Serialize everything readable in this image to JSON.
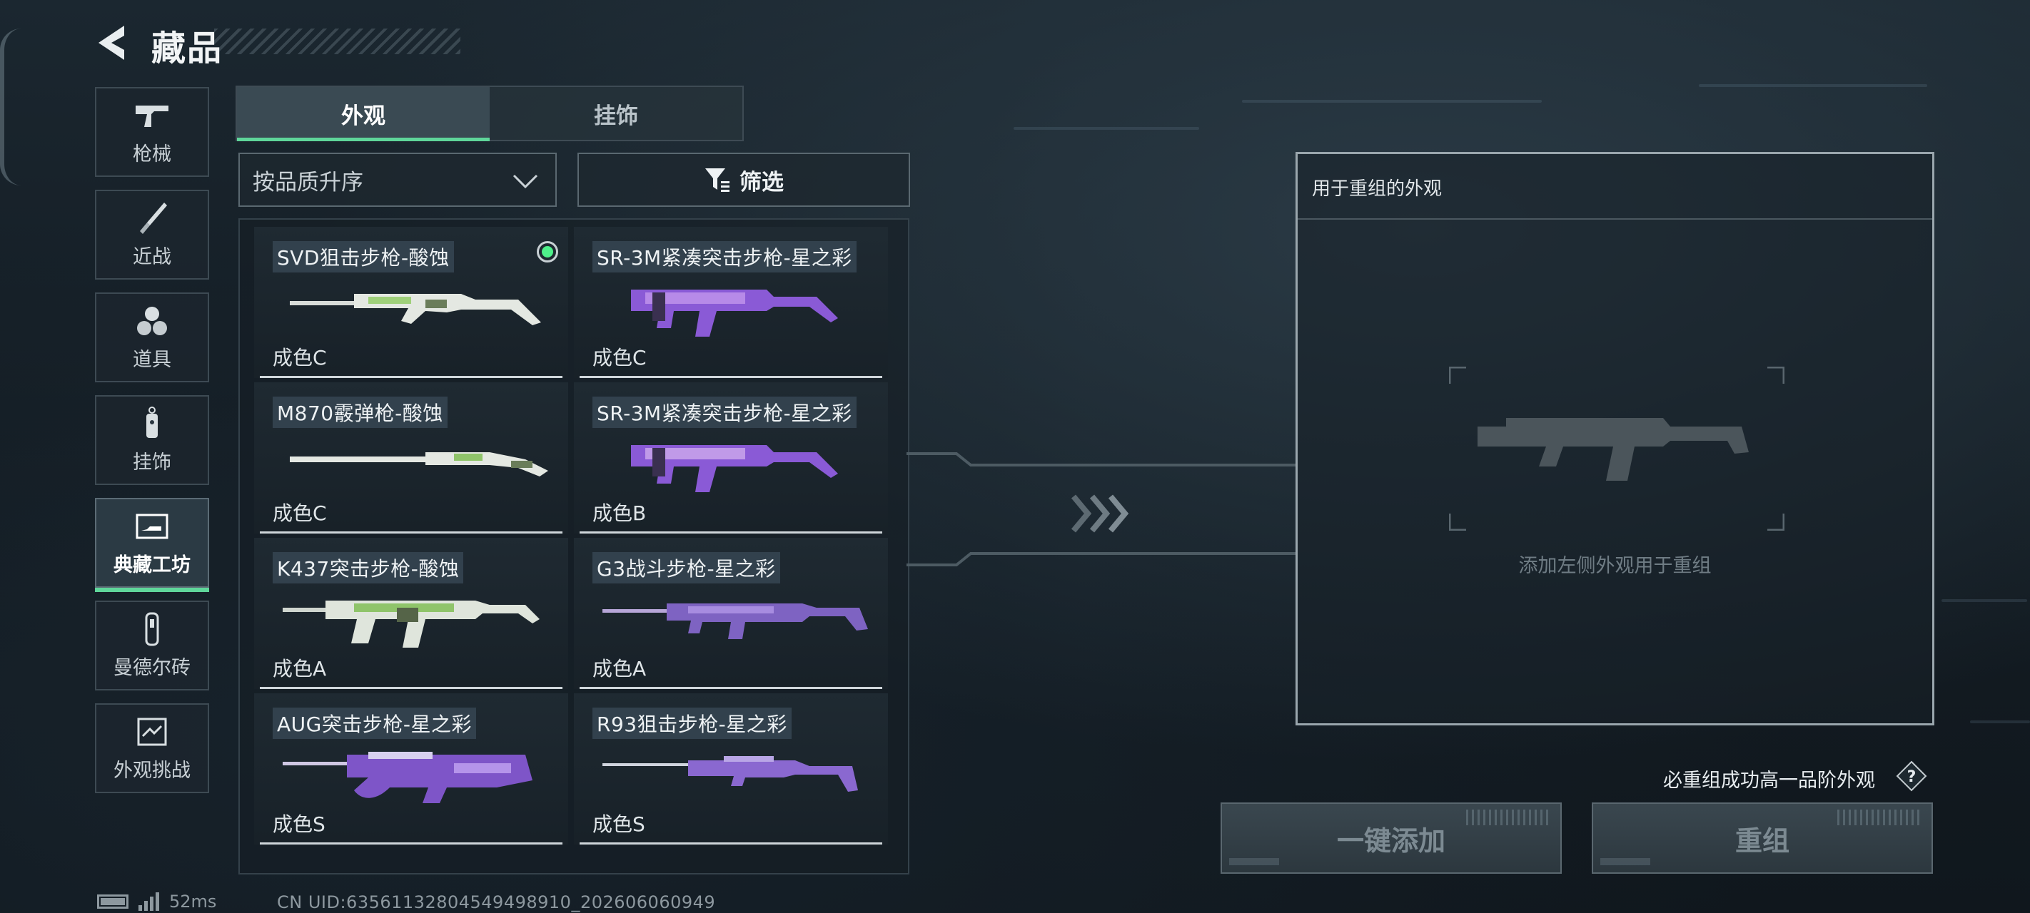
{
  "header": {
    "title": "藏品"
  },
  "nav": {
    "items": [
      {
        "label": "枪械",
        "icon": "gun-icon"
      },
      {
        "label": "近战",
        "icon": "knife-icon"
      },
      {
        "label": "道具",
        "icon": "grenades-icon"
      },
      {
        "label": "挂饰",
        "icon": "charm-icon"
      },
      {
        "label": "典藏工坊",
        "icon": "workshop-icon",
        "active": true
      },
      {
        "label": "曼德尔砖",
        "icon": "mandel-brick-icon"
      },
      {
        "label": "外观挑战",
        "icon": "challenge-icon"
      }
    ]
  },
  "tabs": [
    {
      "label": "外观",
      "active": true
    },
    {
      "label": "挂饰",
      "active": false
    }
  ],
  "sort": {
    "value": "按品质升序"
  },
  "filter": {
    "label": "筛选"
  },
  "items": [
    {
      "name": "SVD狙击步枪-酸蚀",
      "grade": "成色C",
      "equipped": true
    },
    {
      "name": "SR-3M紧凑突击步枪-星之彩",
      "grade": "成色C"
    },
    {
      "name": "M870霰弹枪-酸蚀",
      "grade": "成色C"
    },
    {
      "name": "SR-3M紧凑突击步枪-星之彩",
      "grade": "成色B"
    },
    {
      "name": "K437突击步枪-酸蚀",
      "grade": "成色A"
    },
    {
      "name": "G3战斗步枪-星之彩",
      "grade": "成色A"
    },
    {
      "name": "AUG突击步枪-星之彩",
      "grade": "成色S"
    },
    {
      "name": "R93狙击步枪-星之彩",
      "grade": "成色S"
    }
  ],
  "recombine": {
    "panel_title": "用于重组的外观",
    "hint": "添加左侧外观用于重组",
    "guarantee": "必重组成功高一品阶外观",
    "one_click_add": "一键添加",
    "recombine_btn": "重组"
  },
  "status": {
    "ping": "52ms",
    "uid": "CN UID:63561132804549498910_202606060949"
  },
  "colors": {
    "accent_green": "#5fd69a",
    "equipped_dot": "#4ef08a",
    "acid_skin": "#8fc46a",
    "star_skin": "#8a5ad6"
  }
}
